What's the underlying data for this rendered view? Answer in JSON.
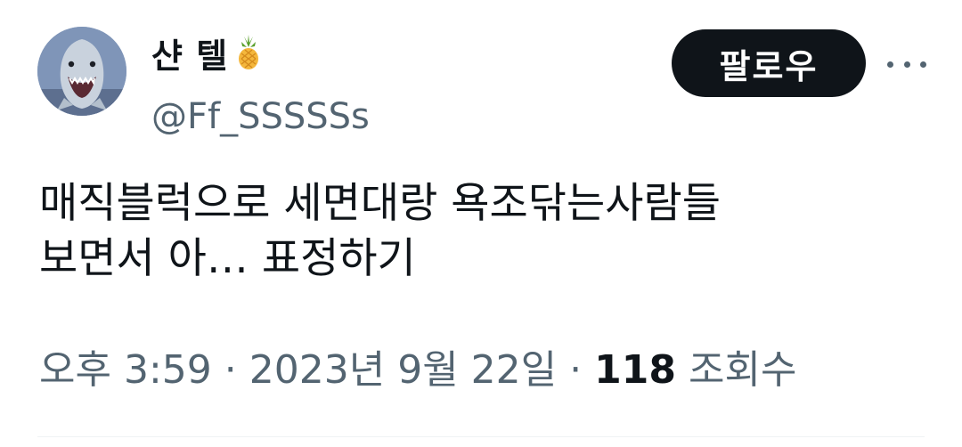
{
  "author": {
    "display_name": "샨 텔",
    "emoji_icon": "pineapple-icon",
    "handle": "@Ff_SSSSSs",
    "avatar_icon": "shark-avatar"
  },
  "actions": {
    "follow_label": "팔로우",
    "more_icon": "more-horizontal-icon"
  },
  "tweet": {
    "text_line_1": "매직블럭으로 세면대랑 욕조닦는사람들",
    "text_line_2": "보면서 아… 표정하기"
  },
  "meta": {
    "time": "오후 3:59",
    "separator": "·",
    "date": "2023년 9월 22일",
    "views_count": "118",
    "views_label": "조회수"
  },
  "colors": {
    "text_primary": "#0f1419",
    "text_secondary": "#536471",
    "button_bg": "#0f1419",
    "button_text": "#ffffff",
    "divider": "#eff3f4"
  }
}
